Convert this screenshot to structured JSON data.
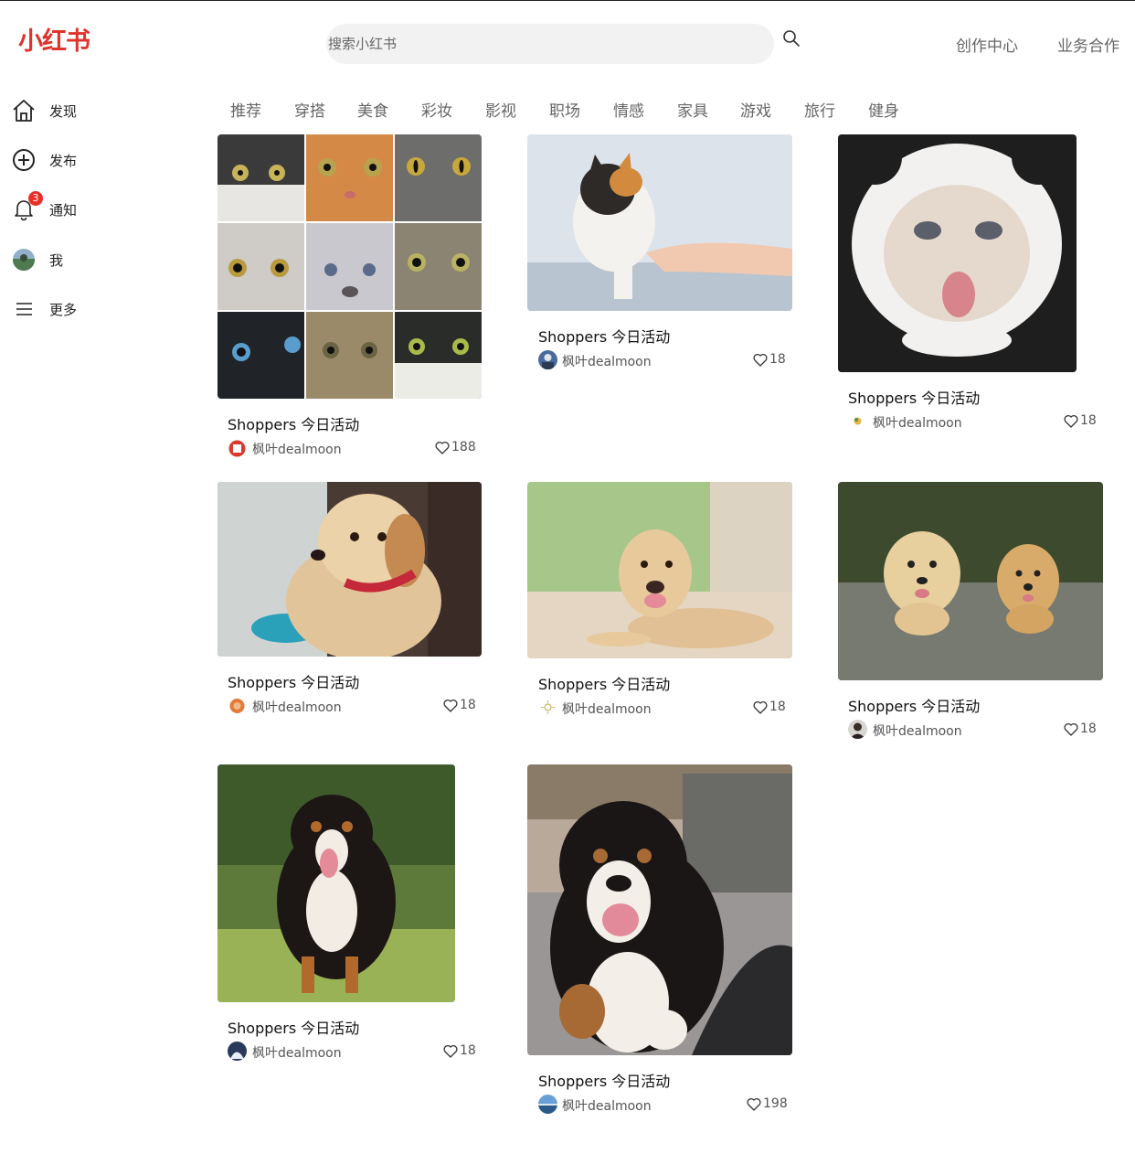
{
  "logo": "小红书",
  "search": {
    "placeholder": "搜索小红书"
  },
  "topnav": [
    "创作中心",
    "业务合作"
  ],
  "sidebar": [
    {
      "label": "发现",
      "icon": "home-icon"
    },
    {
      "label": "发布",
      "icon": "plus-circle-icon"
    },
    {
      "label": "通知",
      "icon": "bell-icon",
      "badge": "3"
    },
    {
      "label": "我",
      "icon": "avatar"
    },
    {
      "label": "更多",
      "icon": "menu-icon"
    }
  ],
  "tabs": [
    "推荐",
    "穿搭",
    "美食",
    "彩妆",
    "影视",
    "职场",
    "情感",
    "家具",
    "游戏",
    "旅行",
    "健身"
  ],
  "cards": [
    {
      "title": "Shoppers 今日活动",
      "author": "枫叶dealmoon",
      "likes": "188",
      "image": "cat-collage"
    },
    {
      "title": "Shoppers 今日活动",
      "author": "枫叶dealmoon",
      "likes": "18",
      "image": "calico-cat"
    },
    {
      "title": "Shoppers 今日活动",
      "author": "枫叶dealmoon",
      "likes": "18",
      "image": "panda-costume-cat"
    },
    {
      "title": "Shoppers 今日活动",
      "author": "枫叶dealmoon",
      "likes": "18",
      "image": "golden-puppy"
    },
    {
      "title": "Shoppers 今日活动",
      "author": "枫叶dealmoon",
      "likes": "18",
      "image": "labrador-puppy"
    },
    {
      "title": "Shoppers 今日活动",
      "author": "枫叶dealmoon",
      "likes": "18",
      "image": "two-puppies"
    },
    {
      "title": "Shoppers 今日活动",
      "author": "枫叶dealmoon",
      "likes": "18",
      "image": "bernese-dog"
    },
    {
      "title": "Shoppers 今日活动",
      "author": "枫叶dealmoon",
      "likes": "198",
      "image": "bernese-puppy"
    }
  ],
  "colors": {
    "brand": "#e0332c",
    "badge": "#e8312b",
    "search_bg": "#f2f2f2"
  }
}
